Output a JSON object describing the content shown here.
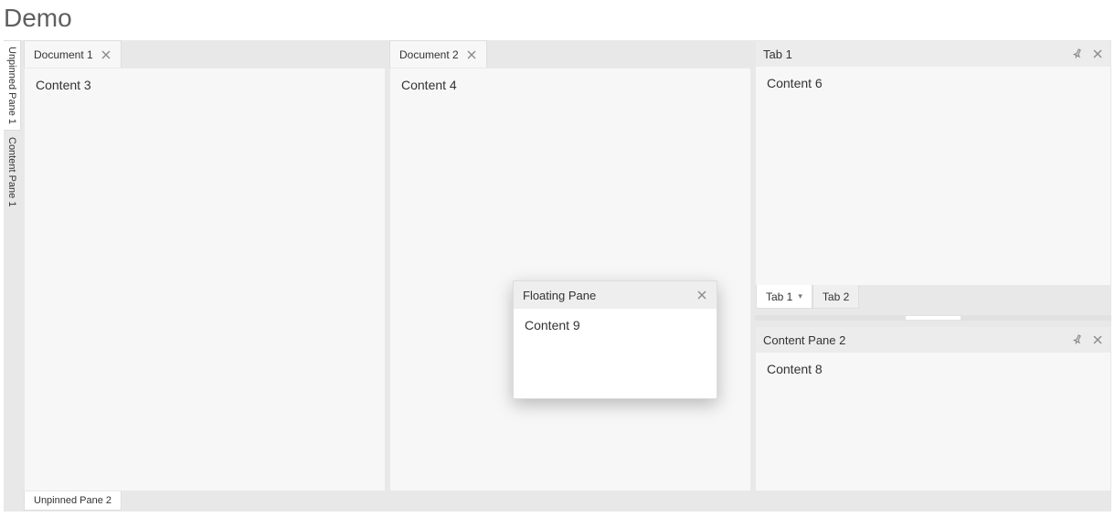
{
  "title": "Demo",
  "left_unpinned": [
    {
      "label": "Unpinned Pane 1"
    },
    {
      "label": "Content Pane 1"
    }
  ],
  "bottom_unpinned": [
    {
      "label": "Unpinned Pane 2"
    }
  ],
  "documents": [
    {
      "tab_label": "Document 1",
      "content": "Content 3"
    },
    {
      "tab_label": "Document 2",
      "content": "Content 4"
    }
  ],
  "right_top_panel": {
    "title": "Tab 1",
    "content": "Content 6",
    "tabs": [
      {
        "label": "Tab 1"
      },
      {
        "label": "Tab 2"
      }
    ]
  },
  "right_bottom_panel": {
    "title": "Content Pane 2",
    "content": "Content 8"
  },
  "floating_pane": {
    "title": "Floating Pane",
    "content": "Content 9"
  }
}
